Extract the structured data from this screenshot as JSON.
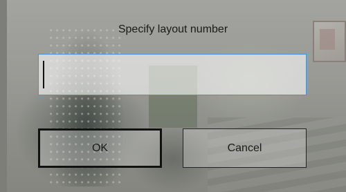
{
  "dialog": {
    "prompt": "Specify layout number",
    "input_value": "",
    "ok_label": "OK",
    "cancel_label": "Cancel"
  },
  "colors": {
    "input_focus_border": "#4a90d9",
    "default_button_border": "#111111"
  }
}
